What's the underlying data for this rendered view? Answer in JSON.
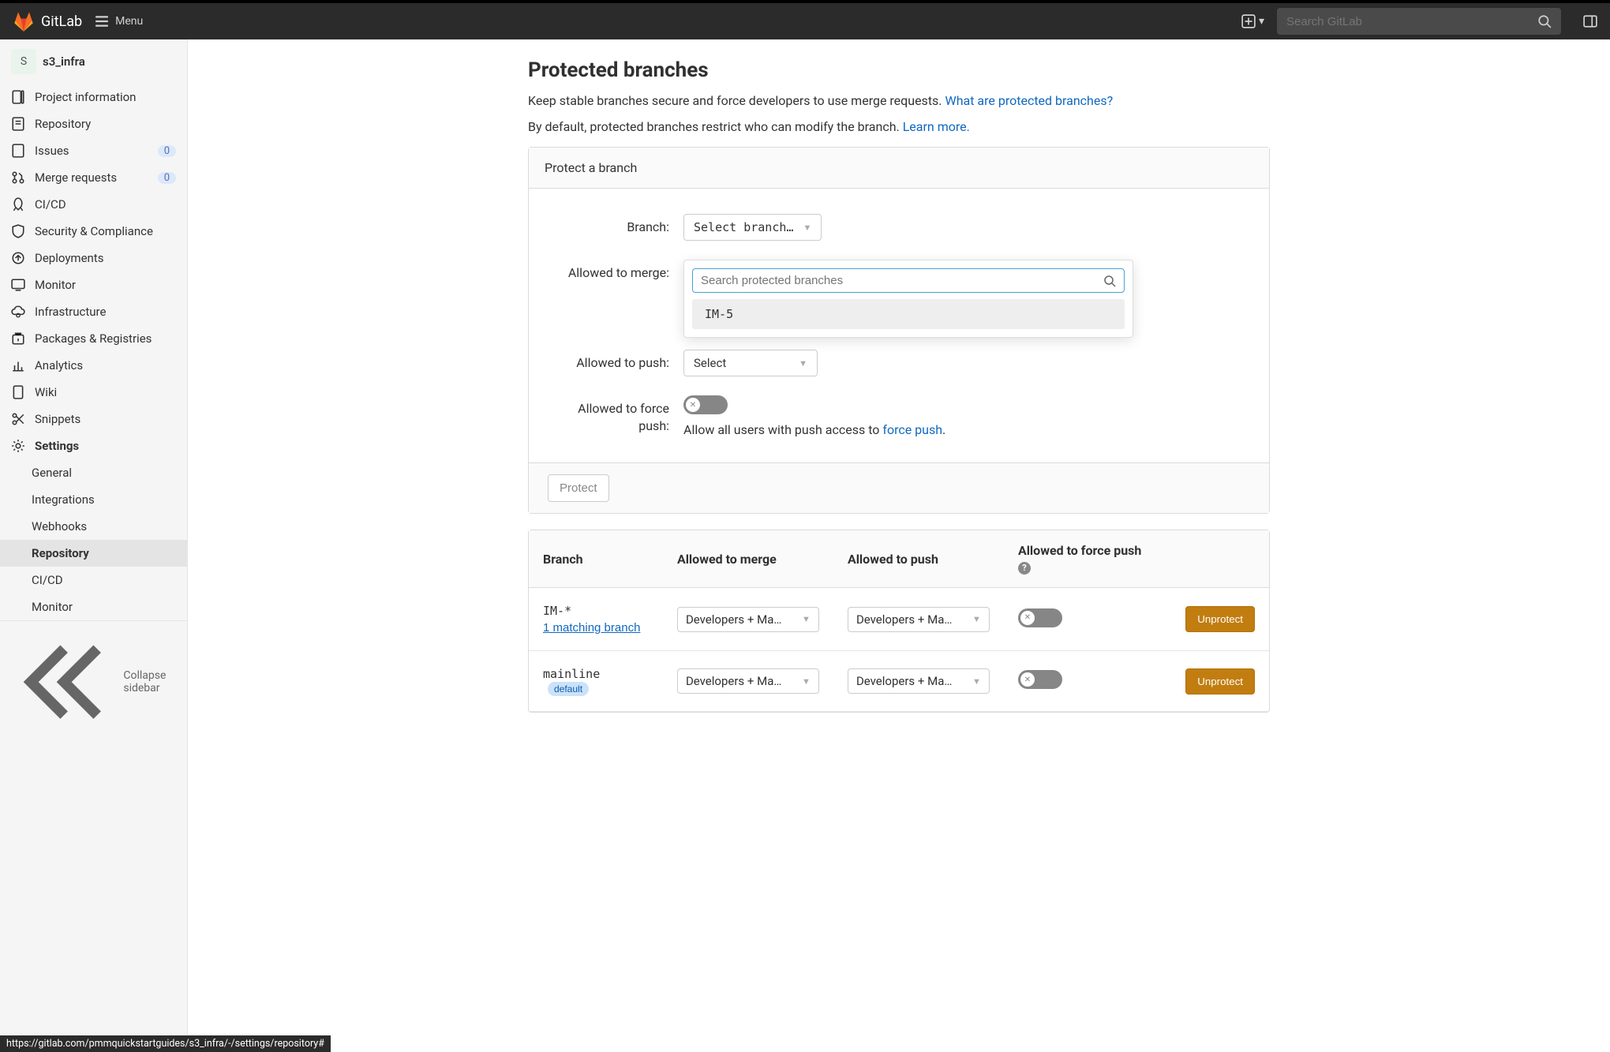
{
  "top": {
    "product": "GitLab",
    "menu": "Menu",
    "search_placeholder": "Search GitLab"
  },
  "project": {
    "initial": "S",
    "name": "s3_infra"
  },
  "sidebar": {
    "items": [
      {
        "icon": "info",
        "label": "Project information"
      },
      {
        "icon": "repo",
        "label": "Repository"
      },
      {
        "icon": "issues",
        "label": "Issues",
        "count": "0"
      },
      {
        "icon": "merge",
        "label": "Merge requests",
        "count": "0"
      },
      {
        "icon": "cicd",
        "label": "CI/CD"
      },
      {
        "icon": "shield",
        "label": "Security & Compliance"
      },
      {
        "icon": "deploy",
        "label": "Deployments"
      },
      {
        "icon": "monitor",
        "label": "Monitor"
      },
      {
        "icon": "infra",
        "label": "Infrastructure"
      },
      {
        "icon": "pkg",
        "label": "Packages & Registries"
      },
      {
        "icon": "analytics",
        "label": "Analytics"
      },
      {
        "icon": "wiki",
        "label": "Wiki"
      },
      {
        "icon": "snippets",
        "label": "Snippets"
      },
      {
        "icon": "settings",
        "label": "Settings",
        "bold": true
      }
    ],
    "subitems": [
      "General",
      "Integrations",
      "Webhooks",
      "Repository",
      "CI/CD",
      "Monitor"
    ],
    "collapse": "Collapse sidebar"
  },
  "page": {
    "title": "Protected branches",
    "desc1_a": "Keep stable branches secure and force developers to use merge requests. ",
    "desc1_link": "What are protected branches?",
    "desc2_a": "By default, protected branches restrict who can modify the branch. ",
    "desc2_link": "Learn more."
  },
  "panel": {
    "header": "Protect a branch",
    "branch_label": "Branch:",
    "branch_dd": "Select branch…",
    "search_placeholder": "Search protected branches",
    "search_result": "IM-5",
    "merge_label": "Allowed to merge:",
    "push_label": "Allowed to push:",
    "push_dd": "Select",
    "force_label": "Allowed to force push:",
    "force_help_a": "Allow all users with push access to ",
    "force_help_link": "force push",
    "protect_btn": "Protect"
  },
  "table": {
    "cols": {
      "branch": "Branch",
      "merge": "Allowed to merge",
      "push": "Allowed to push",
      "force": "Allowed to force push"
    },
    "rows": [
      {
        "name": "IM-*",
        "match": "1 matching branch",
        "merge": "Developers + Ma…",
        "push": "Developers + Ma…",
        "btn": "Unprotect"
      },
      {
        "name": "mainline",
        "default": "default",
        "merge": "Developers + Ma…",
        "push": "Developers + Ma…",
        "btn": "Unprotect"
      }
    ]
  },
  "statusbar": "https://gitlab.com/pmmquickstartguides/s3_infra/-/settings/repository#"
}
